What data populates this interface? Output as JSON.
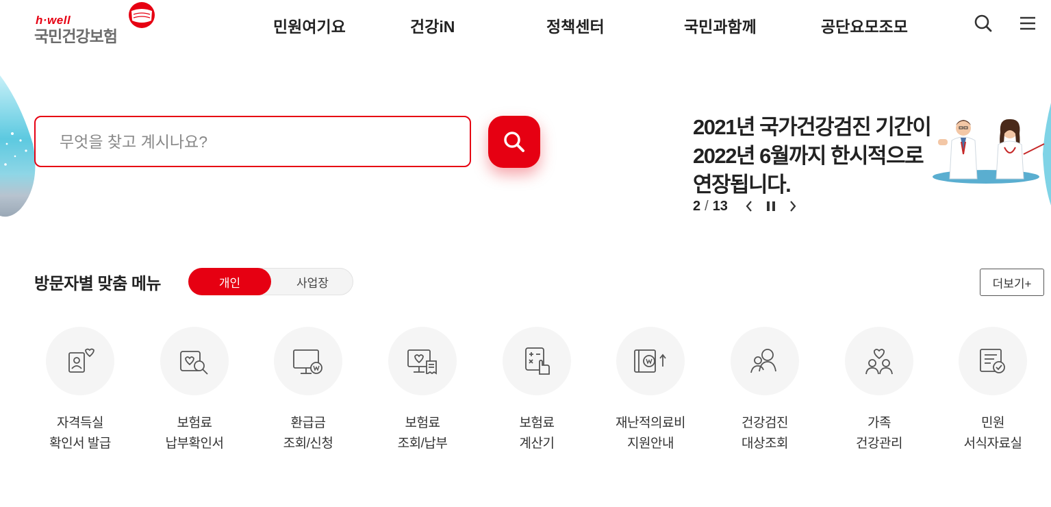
{
  "logo": {
    "tagline": "h·well",
    "name": "국민건강보험"
  },
  "gnb": [
    {
      "label": "민원여기요"
    },
    {
      "label": "건강iN"
    },
    {
      "label": "정책센터"
    },
    {
      "label": "국민과함께"
    },
    {
      "label": "공단요모조모"
    }
  ],
  "header_icons": [
    "search-icon",
    "menu-icon"
  ],
  "search": {
    "placeholder": "무엇을 찾고 계시나요?",
    "value": ""
  },
  "banner": {
    "lines": [
      "2021년 국가건강검진 기간이",
      "2022년 6월까지 한시적으로",
      "연장됩니다."
    ],
    "current": "2",
    "separator": "/",
    "total": "13"
  },
  "custom_menu": {
    "title": "방문자별 맞춤 메뉴",
    "tabs": [
      {
        "label": "개인",
        "active": true
      },
      {
        "label": "사업장",
        "active": false
      }
    ],
    "more": "더보기+"
  },
  "quick_menu": [
    {
      "line1": "자격득실",
      "line2": "확인서 발급",
      "icon": "certificate-icon"
    },
    {
      "line1": "보험료",
      "line2": "납부확인서",
      "icon": "payment-search-icon"
    },
    {
      "line1": "환급금",
      "line2": "조회/신청",
      "icon": "refund-monitor-icon"
    },
    {
      "line1": "보험료",
      "line2": "조회/납부",
      "icon": "premium-bill-icon"
    },
    {
      "line1": "보험료",
      "line2": "계산기",
      "icon": "calculator-icon"
    },
    {
      "line1": "재난적의료비",
      "line2": "지원안내",
      "icon": "medical-support-icon"
    },
    {
      "line1": "건강검진",
      "line2": "대상조회",
      "icon": "checkup-target-icon"
    },
    {
      "line1": "가족",
      "line2": "건강관리",
      "icon": "family-health-icon"
    },
    {
      "line1": "민원",
      "line2": "서식자료실",
      "icon": "form-document-icon"
    }
  ],
  "colors": {
    "accent": "#e60012",
    "icon": "#555555",
    "circle_bg": "#f5f5f5"
  }
}
